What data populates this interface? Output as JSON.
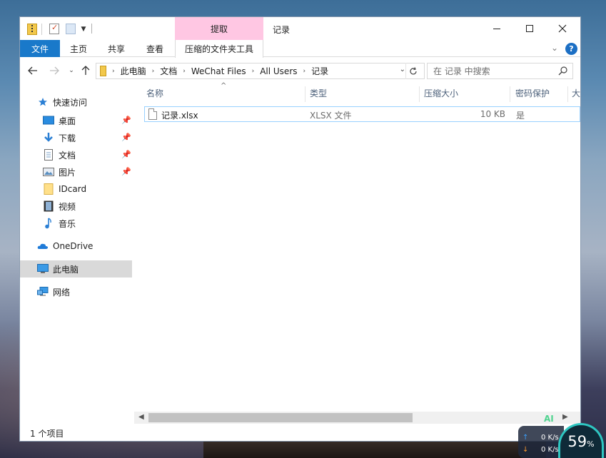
{
  "window": {
    "title": "记录",
    "context_tab": "提取"
  },
  "ribbon": {
    "tabs": [
      "文件",
      "主页",
      "共享",
      "查看",
      "压缩的文件夹工具"
    ],
    "help_label": "?"
  },
  "address": {
    "crumbs": [
      "此电脑",
      "文档",
      "WeChat Files",
      "All Users",
      "记录"
    ]
  },
  "search": {
    "placeholder": "在 记录 中搜索"
  },
  "navpane": {
    "quick_access": "快速访问",
    "items": [
      {
        "label": "桌面",
        "pinned": true
      },
      {
        "label": "下载",
        "pinned": true
      },
      {
        "label": "文档",
        "pinned": true
      },
      {
        "label": "图片",
        "pinned": true
      },
      {
        "label": "IDcard",
        "pinned": false
      },
      {
        "label": "视频",
        "pinned": false
      },
      {
        "label": "音乐",
        "pinned": false
      }
    ],
    "onedrive": "OneDrive",
    "this_pc": "此电脑",
    "network": "网络"
  },
  "filelist": {
    "columns": [
      "名称",
      "类型",
      "压缩大小",
      "密码保护",
      "大"
    ],
    "rows": [
      {
        "name": "记录.xlsx",
        "type": "XLSX 文件",
        "size": "10 KB",
        "protected": "是"
      }
    ]
  },
  "status": {
    "item_count": "1 个项目"
  },
  "netwidget": {
    "up_speed": "0 K/s",
    "down_speed": "0 K/s",
    "percent": "59",
    "percent_unit": "%",
    "badge": "AI"
  },
  "colors": {
    "file_tab": "#1979ca",
    "context_tab": "#ffc7e3",
    "selected_row_border": "#99d1ff",
    "widget_ring": "#2ec6c1"
  }
}
